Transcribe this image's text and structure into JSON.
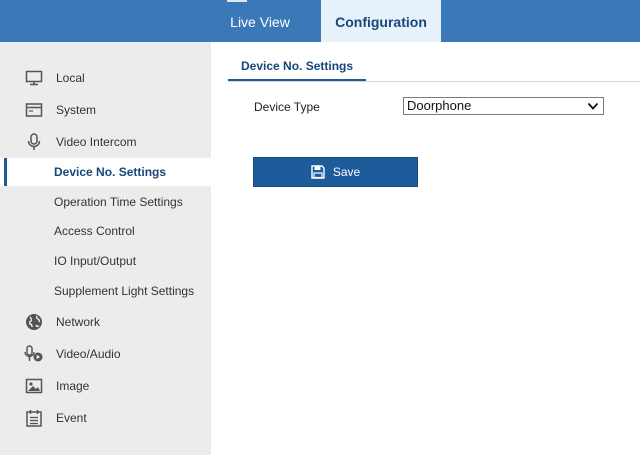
{
  "header": {
    "tabs": [
      {
        "label": "Live View"
      },
      {
        "label": "Configuration"
      }
    ]
  },
  "sidebar": {
    "items": [
      {
        "label": "Local",
        "icon": "monitor-icon"
      },
      {
        "label": "System",
        "icon": "system-window-icon"
      },
      {
        "label": "Video Intercom",
        "icon": "microphone-icon"
      },
      {
        "label": "Device No. Settings",
        "active": true
      },
      {
        "label": "Operation Time Settings"
      },
      {
        "label": "Access Control"
      },
      {
        "label": "IO Input/Output"
      },
      {
        "label": "Supplement Light Settings"
      },
      {
        "label": "Network",
        "icon": "globe-icon"
      },
      {
        "label": "Video/Audio",
        "icon": "mic-video-icon"
      },
      {
        "label": "Image",
        "icon": "image-icon"
      },
      {
        "label": "Event",
        "icon": "calendar-list-icon"
      }
    ]
  },
  "main": {
    "subtab": "Device No. Settings",
    "device_type_label": "Device Type",
    "device_type_value": "Doorphone",
    "save_label": "Save"
  },
  "colors": {
    "header_bg": "#3b78b8",
    "active_tab_bg": "#e6f1fa",
    "accent": "#1d5b9a",
    "sidebar_bg": "#ececec"
  }
}
